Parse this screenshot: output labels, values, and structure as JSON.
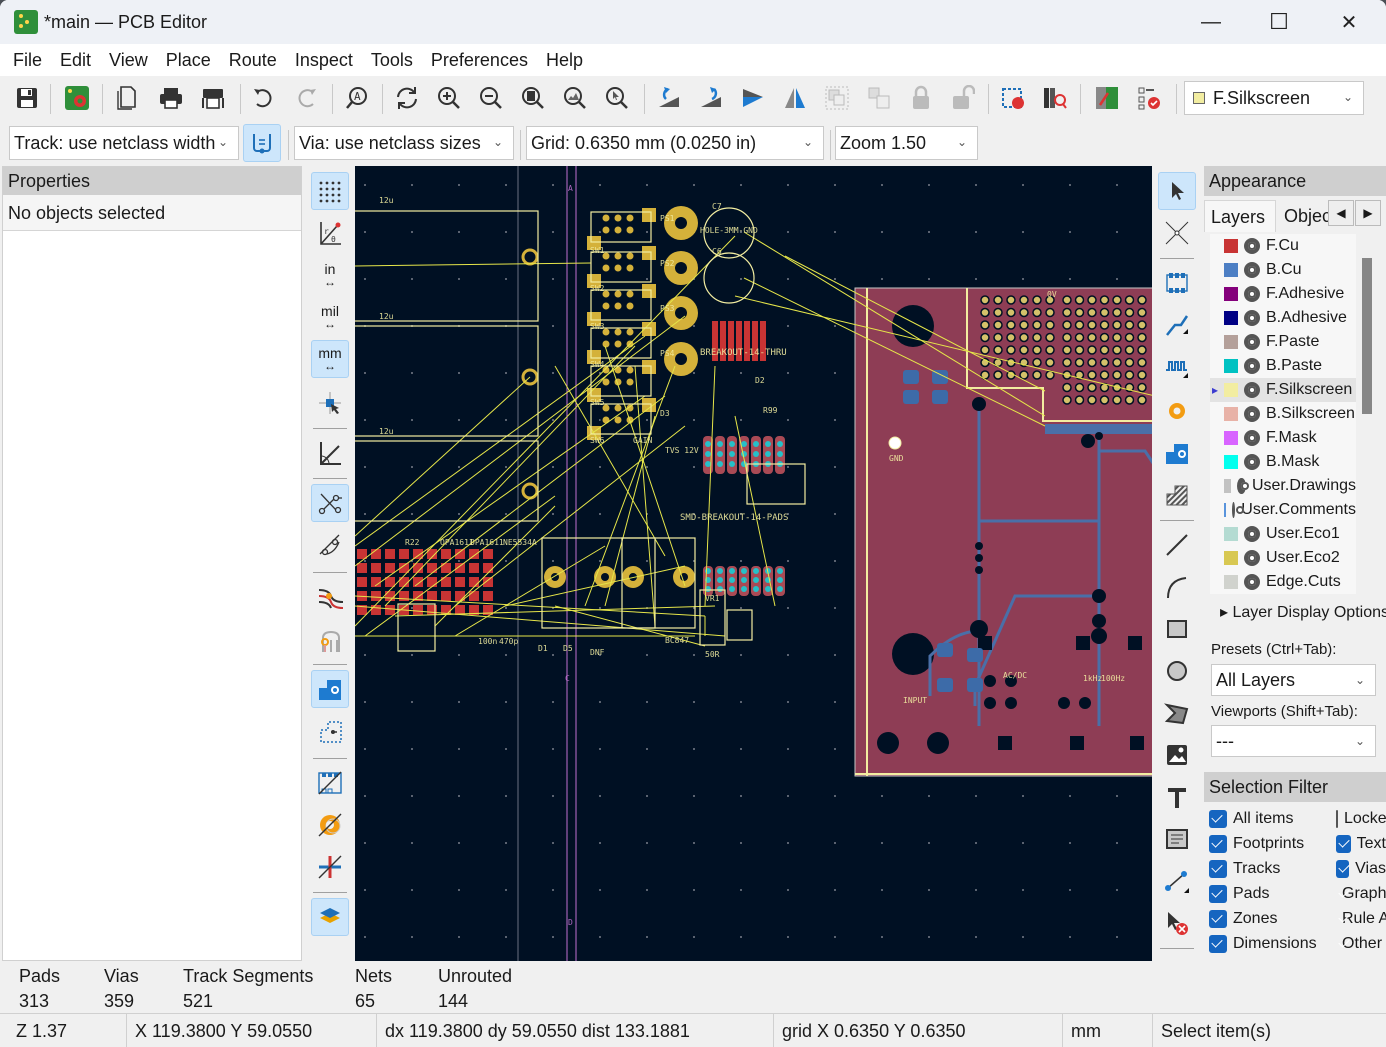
{
  "window": {
    "title": "*main — PCB Editor",
    "controls": {
      "minimize": "—",
      "maximize": "☐",
      "close": "✕"
    }
  },
  "menubar": [
    "File",
    "Edit",
    "View",
    "Place",
    "Route",
    "Inspect",
    "Tools",
    "Preferences",
    "Help"
  ],
  "toolbar": {
    "buttons": [
      "save",
      "board-setup",
      "page-settings",
      "print",
      "plot",
      "undo",
      "redo",
      "find",
      "refresh",
      "zoom-in",
      "zoom-out",
      "zoom-fit",
      "zoom-fit-objects",
      "zoom-selection",
      "rotate-ccw",
      "rotate-cw",
      "flip",
      "mirror",
      "group",
      "ungroup",
      "lock",
      "unlock",
      "netlist",
      "footprint-browser",
      "update-pcb",
      "drc"
    ],
    "layer_select": {
      "value": "F.Silkscreen",
      "swatch": "#f2eda1"
    }
  },
  "toolbar2": {
    "track": "Track: use netclass width",
    "via": "Via: use netclass sizes",
    "grid": "Grid: 0.6350 mm (0.0250 in)",
    "zoom": "Zoom 1.50"
  },
  "properties": {
    "title": "Properties",
    "status": "No objects selected"
  },
  "left_toolbar": {
    "items": [
      {
        "name": "grid",
        "active": true
      },
      {
        "name": "polar-coords",
        "active": false
      },
      {
        "name": "units-in",
        "label": "in",
        "active": false
      },
      {
        "name": "units-mil",
        "label": "mil",
        "active": false
      },
      {
        "name": "units-mm",
        "label": "mm",
        "active": true
      },
      {
        "name": "cursor-crosshair",
        "active": false
      },
      {
        "name": "angle-snap",
        "active": false
      },
      {
        "name": "ratsnest",
        "active": true
      },
      {
        "name": "curved-ratsnest",
        "active": false
      },
      {
        "name": "net-highlight",
        "active": false
      },
      {
        "name": "track-outline",
        "active": false
      },
      {
        "name": "zone-fill",
        "active": true
      },
      {
        "name": "zone-outline",
        "active": false
      },
      {
        "name": "footprint-outline",
        "active": false
      },
      {
        "name": "via-outline",
        "active": false
      },
      {
        "name": "track-outline-2",
        "active": false
      },
      {
        "name": "layers-manager",
        "active": true
      }
    ]
  },
  "right_toolbar": {
    "items": [
      "select",
      "local-ratsnest",
      "add-footprint",
      "route-track",
      "tune-length",
      "add-via",
      "add-zone",
      "add-rule-area",
      "draw-line",
      "draw-arc",
      "draw-rectangle",
      "draw-circle",
      "draw-polygon",
      "add-image",
      "add-text",
      "add-textbox",
      "add-dimension",
      "delete"
    ]
  },
  "canvas": {
    "labels": [
      "12u",
      "12u",
      "12u",
      "A",
      "C",
      "D",
      "C7",
      "C6",
      "SW1",
      "SW2",
      "SW3",
      "SW4",
      "SW5",
      "SW6",
      "PS1",
      "PS2",
      "PS3",
      "PS4",
      "HOLE-3MM-GND",
      "BREAKOUT-14-THRU",
      "SMD-BREAKOUT-14-PADS",
      "D2",
      "D3",
      "R99",
      "R22",
      "OPA1611",
      "OPA1611",
      "NE5534A",
      "GAIN",
      "TVS 12V",
      "VR1",
      "50R",
      "BC847",
      "D1",
      "D5",
      "DNF",
      "100n",
      "470p",
      "GND",
      "INPUT",
      "AC/DC",
      "1kHz",
      "100Hz",
      "0V"
    ]
  },
  "appearance": {
    "title": "Appearance",
    "tabs": [
      "Layers",
      "Objec"
    ],
    "layers": [
      {
        "name": "F.Cu",
        "color": "#c83434"
      },
      {
        "name": "B.Cu",
        "color": "#4d7fc4"
      },
      {
        "name": "F.Adhesive",
        "color": "#84007b"
      },
      {
        "name": "B.Adhesive",
        "color": "#000084"
      },
      {
        "name": "F.Paste",
        "color": "#b4a09a"
      },
      {
        "name": "B.Paste",
        "color": "#00c2c2"
      },
      {
        "name": "F.Silkscreen",
        "color": "#f2eda1",
        "selected": true
      },
      {
        "name": "B.Silkscreen",
        "color": "#e8b2a7"
      },
      {
        "name": "F.Mask",
        "color": "#d864ff"
      },
      {
        "name": "B.Mask",
        "color": "#02ffee"
      },
      {
        "name": "User.Drawings",
        "color": "#c2c2c2"
      },
      {
        "name": "User.Comments",
        "color": "#5994dc"
      },
      {
        "name": "User.Eco1",
        "color": "#b4dbd2"
      },
      {
        "name": "User.Eco2",
        "color": "#d8c852"
      },
      {
        "name": "Edge.Cuts",
        "color": "#d0d2cd"
      }
    ],
    "layer_display_options": "Layer Display Options",
    "presets_label": "Presets (Ctrl+Tab):",
    "presets_value": "All Layers",
    "viewports_label": "Viewports (Shift+Tab):",
    "viewports_value": "---"
  },
  "selection_filter": {
    "title": "Selection Filter",
    "left": [
      {
        "label": "All items",
        "checked": true
      },
      {
        "label": "Footprints",
        "checked": true
      },
      {
        "label": "Tracks",
        "checked": true
      },
      {
        "label": "Pads",
        "checked": true
      },
      {
        "label": "Zones",
        "checked": true
      },
      {
        "label": "Dimensions",
        "checked": true
      }
    ],
    "right": [
      {
        "label": "Locked items",
        "checked": false
      },
      {
        "label": "Text",
        "checked": true
      },
      {
        "label": "Vias",
        "checked": true
      },
      {
        "label": "Graphics",
        "checked": true
      },
      {
        "label": "Rule Areas",
        "checked": true
      },
      {
        "label": "Other items",
        "checked": true
      }
    ]
  },
  "stats": [
    {
      "label": "Pads",
      "value": "313"
    },
    {
      "label": "Vias",
      "value": "359"
    },
    {
      "label": "Track Segments",
      "value": "521"
    },
    {
      "label": "Nets",
      "value": "65"
    },
    {
      "label": "Unrouted",
      "value": "144"
    }
  ],
  "statusbar": {
    "zoom": "Z 1.37",
    "coords": "X 119.3800  Y 59.0550",
    "delta": "dx 119.3800  dy 59.0550  dist 133.1881",
    "grid": "grid X 0.6350  Y 0.6350",
    "units": "mm",
    "mode": "Select item(s)"
  }
}
